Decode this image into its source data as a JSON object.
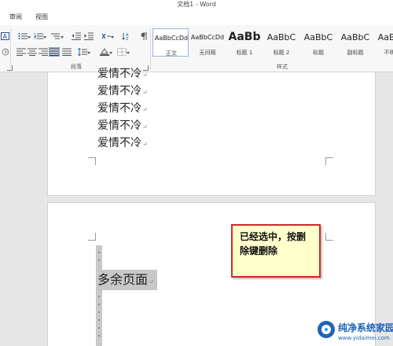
{
  "window": {
    "title": "文档1 - Word"
  },
  "tabs": [
    {
      "label": "审阅"
    },
    {
      "label": "视图"
    }
  ],
  "ribbon": {
    "paragraph_group_label": "段落",
    "styles_group_label": "样式",
    "styles": [
      {
        "sample": "AaBbCcDd",
        "name": "正文",
        "active": true
      },
      {
        "sample": "AaBbCcDd",
        "name": "无间隔"
      },
      {
        "sample": "AaBb",
        "name": "标题 1"
      },
      {
        "sample": "AaBbC",
        "name": "标题 2"
      },
      {
        "sample": "AaBbC",
        "name": "标题"
      },
      {
        "sample": "AaBbC",
        "name": "副标题"
      },
      {
        "sample": "AaBbC",
        "name": "不明显"
      }
    ]
  },
  "document": {
    "page1_lines": [
      "爱情不冷",
      "爱情不冷",
      "爱情不冷",
      "爱情不冷",
      "爱情不冷"
    ],
    "paragraph_mark": "↵",
    "page2_selected_text": "多余页面"
  },
  "callout": {
    "text": "已经选中，按删除键删除"
  },
  "watermark": {
    "name": "纯净系统家园",
    "url": "www.yidaimei.com"
  },
  "colors": {
    "accent": "#2b579a",
    "selection": "#c8c8c8",
    "callout_border": "#cc2b2b",
    "callout_fill": "#ffffcc"
  }
}
